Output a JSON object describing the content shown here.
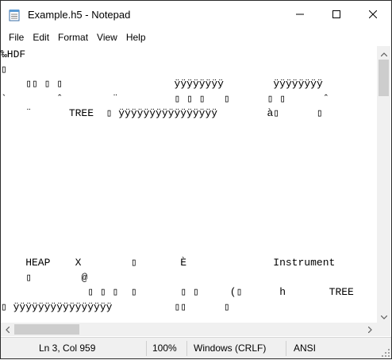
{
  "window": {
    "title": "Example.h5 - Notepad",
    "app_icon": "notepad-icon",
    "controls": [
      "minimize-icon",
      "maximize-icon",
      "close-icon"
    ]
  },
  "menu": {
    "items": [
      "File",
      "Edit",
      "Format",
      "View",
      "Help"
    ]
  },
  "editor": {
    "lines": [
      "‰HDF",
      "",
      "     ",
      "`        ˆ        ¨     ",
      "      ¨      TREE   ÿÿÿÿÿÿÿÿÿÿÿÿÿÿÿÿ",
      "",
      "     HEAP     X         È               Instrument",
      "             @",
      "                          (      h        TREE",
      " ÿÿÿÿÿÿÿÿÿÿÿÿÿÿÿÿ           "
    ],
    "row_glyphs": {
      "row2": "         ÿÿÿÿÿÿÿÿ        ÿÿÿÿÿÿÿÿ",
      "row3": "`        ˆ        ¨"
    }
  },
  "status": {
    "position": "Ln 3, Col 959",
    "zoom": "100%",
    "line_ending": "Windows (CRLF)",
    "encoding": "ANSI"
  }
}
